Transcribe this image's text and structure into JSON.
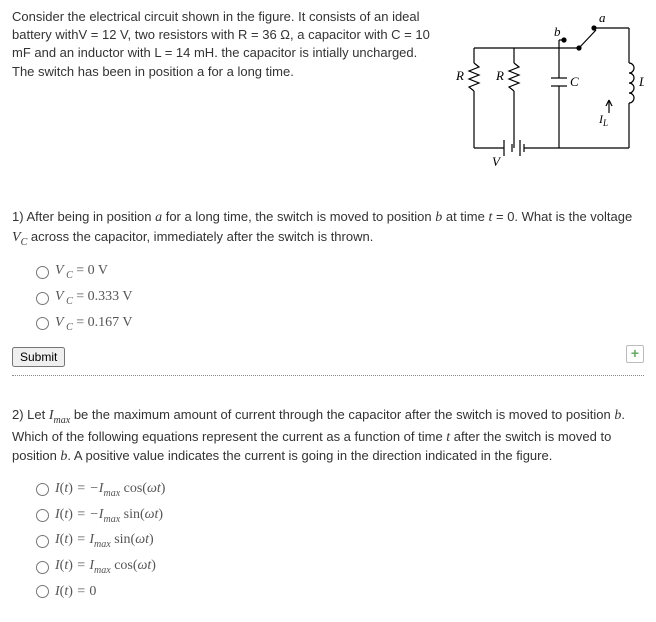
{
  "intro": "Consider the electrical circuit shown in the figure. It consists of an ideal battery withV = 12 V, two resistors with R = 36 Ω, a capacitor with C = 10 mF and an inductor with L = 14 mH. the capacitor is intially uncharged. The switch has been in position a for a long time.",
  "circuit": {
    "labels": {
      "R1": "R",
      "R2": "R",
      "C": "C",
      "L": "L",
      "V": "V",
      "a": "a",
      "b": "b",
      "IL": "I_L"
    }
  },
  "q1": {
    "text": "1) After being in position a for a long time, the switch is moved to position b at time t = 0. What is the voltage V_C across the capacitor, immediately after the switch is thrown.",
    "options": {
      "a": "V_C = 0 V",
      "b": "V_C = 0.333 V",
      "c": "V_C = 0.167 V"
    },
    "submit": "Submit",
    "expand": "+"
  },
  "q2": {
    "text": "2) Let I_max be the maximum amount of current through the capacitor after the switch is moved to position b. Which of the following equations represent the current as a function of time t after the switch is moved to position b. A positive value indicates the current is going in the direction indicated in the figure.",
    "options": {
      "a": "I(t) = -I_max cos(ωt)",
      "b": "I(t) = -I_max sin(ωt)",
      "c": "I(t) = I_max sin(ωt)",
      "d": "I(t) = I_max cos(ωt)",
      "e": "I(t) = 0"
    }
  }
}
